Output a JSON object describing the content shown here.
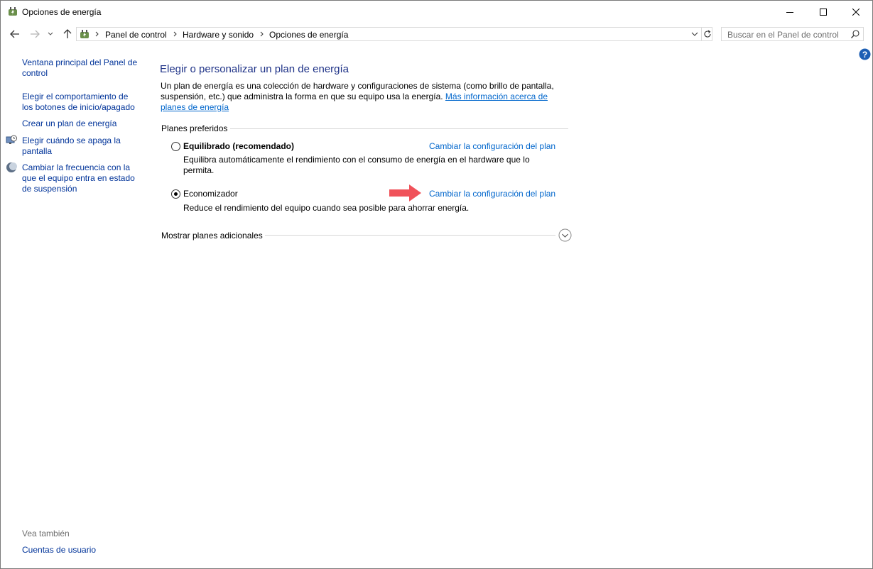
{
  "window": {
    "title": "Opciones de energía",
    "icon": "power-options-icon"
  },
  "address_bar": {
    "breadcrumbs": [
      "Panel de control",
      "Hardware y sonido",
      "Opciones de energía"
    ]
  },
  "search": {
    "placeholder": "Buscar en el Panel de control"
  },
  "sidebar": {
    "links": [
      {
        "label": "Ventana principal del Panel de control",
        "lines": [
          "Ventana principal del Panel de",
          "control"
        ],
        "icon": null
      },
      {
        "label": "Elegir el comportamiento de los botones de inicio/apagado",
        "lines": [
          "Elegir el comportamiento de",
          "los botones de inicio/apagado"
        ],
        "icon": null
      },
      {
        "label": "Crear un plan de energía",
        "lines": [
          "Crear un plan de energía"
        ],
        "icon": null
      },
      {
        "label": "Elegir cuándo se apaga la pantalla",
        "lines": [
          "Elegir cuándo se apaga la",
          "pantalla"
        ],
        "icon": "monitor-clock-icon"
      },
      {
        "label": "Cambiar la frecuencia con la que el equipo entra en estado de suspensión",
        "lines": [
          "Cambiar la frecuencia con la",
          "que el equipo entra en estado",
          "de suspensión"
        ],
        "icon": "moon-icon"
      }
    ],
    "see_also": {
      "label": "Vea también",
      "links": [
        "Cuentas de usuario"
      ]
    }
  },
  "main": {
    "heading": "Elegir o personalizar un plan de energía",
    "description": "Un plan de energía es una colección de hardware y configuraciones de sistema (como brillo de pantalla, suspensión, etc.) que administra la forma en que su equipo usa la energía.",
    "description_link": "Más información acerca de planes de energía",
    "preferred_label": "Planes preferidos",
    "plans": [
      {
        "name": "Equilibrado (recomendado)",
        "selected": false,
        "description": "Equilibra automáticamente el rendimiento con el consumo de energía en el hardware que lo permita.",
        "change_link": "Cambiar la configuración del plan"
      },
      {
        "name": "Economizador",
        "selected": true,
        "description": "Reduce el rendimiento del equipo cuando sea posible para ahorrar energía.",
        "change_link": "Cambiar la configuración del plan"
      }
    ],
    "more_plans_label": "Mostrar planes adicionales"
  },
  "colors": {
    "heading": "#1e3287",
    "link": "#0066cc",
    "sidebar_link": "#003399",
    "annotation_arrow": "#f0525a"
  }
}
